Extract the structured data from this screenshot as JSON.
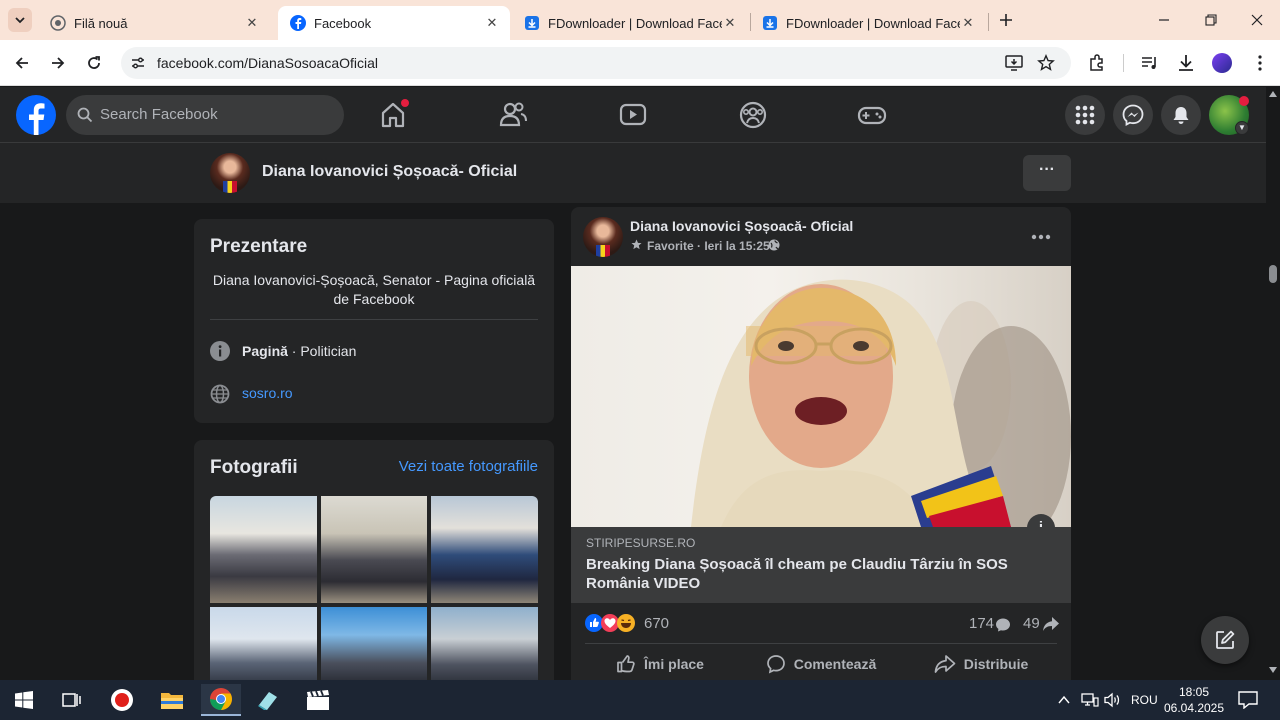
{
  "browser": {
    "tabs": [
      {
        "title": "Filă nouă"
      },
      {
        "title": "Facebook"
      },
      {
        "title": "FDownloader | Download Facebook"
      },
      {
        "title": "FDownloader | Download Facebook"
      }
    ],
    "url": "facebook.com/DianaSosoacaOficial"
  },
  "facebook": {
    "search_placeholder": "Search Facebook",
    "page_name": "Diana Iovanovici Șoșoacă- Oficial",
    "more_label": "···"
  },
  "intro": {
    "title": "Prezentare",
    "bio": "Diana Iovanovici-Șoșoacă, Senator - Pagina oficială de Facebook",
    "category_bold": "Pagină",
    "category_rest": " · Politician",
    "website": "sosro.ro"
  },
  "photos": {
    "title": "Fotografii",
    "see_all": "Vezi toate fotografiile"
  },
  "post": {
    "author": "Diana Iovanovici Șoșoacă- Oficial",
    "meta": "Favorite · Ieri la 15:25 ·",
    "link_source": "STIRIPESURSE.RO",
    "link_title": "Breaking Diana Șoșoacă îl cheam pe Claudiu Târziu în SOS România VIDEO",
    "reactions": "670",
    "comments": "174",
    "shares": "49",
    "like_label": "Îmi place",
    "comment_label": "Comentează",
    "share_label": "Distribuie",
    "info_label": "i"
  },
  "taskbar": {
    "language": "ROU",
    "time": "18:05",
    "date": "06.04.2025"
  },
  "colors": {
    "fb_blue": "#0866ff",
    "link_blue": "#4599ff",
    "card_bg": "#242526",
    "page_bg": "#18191a"
  }
}
